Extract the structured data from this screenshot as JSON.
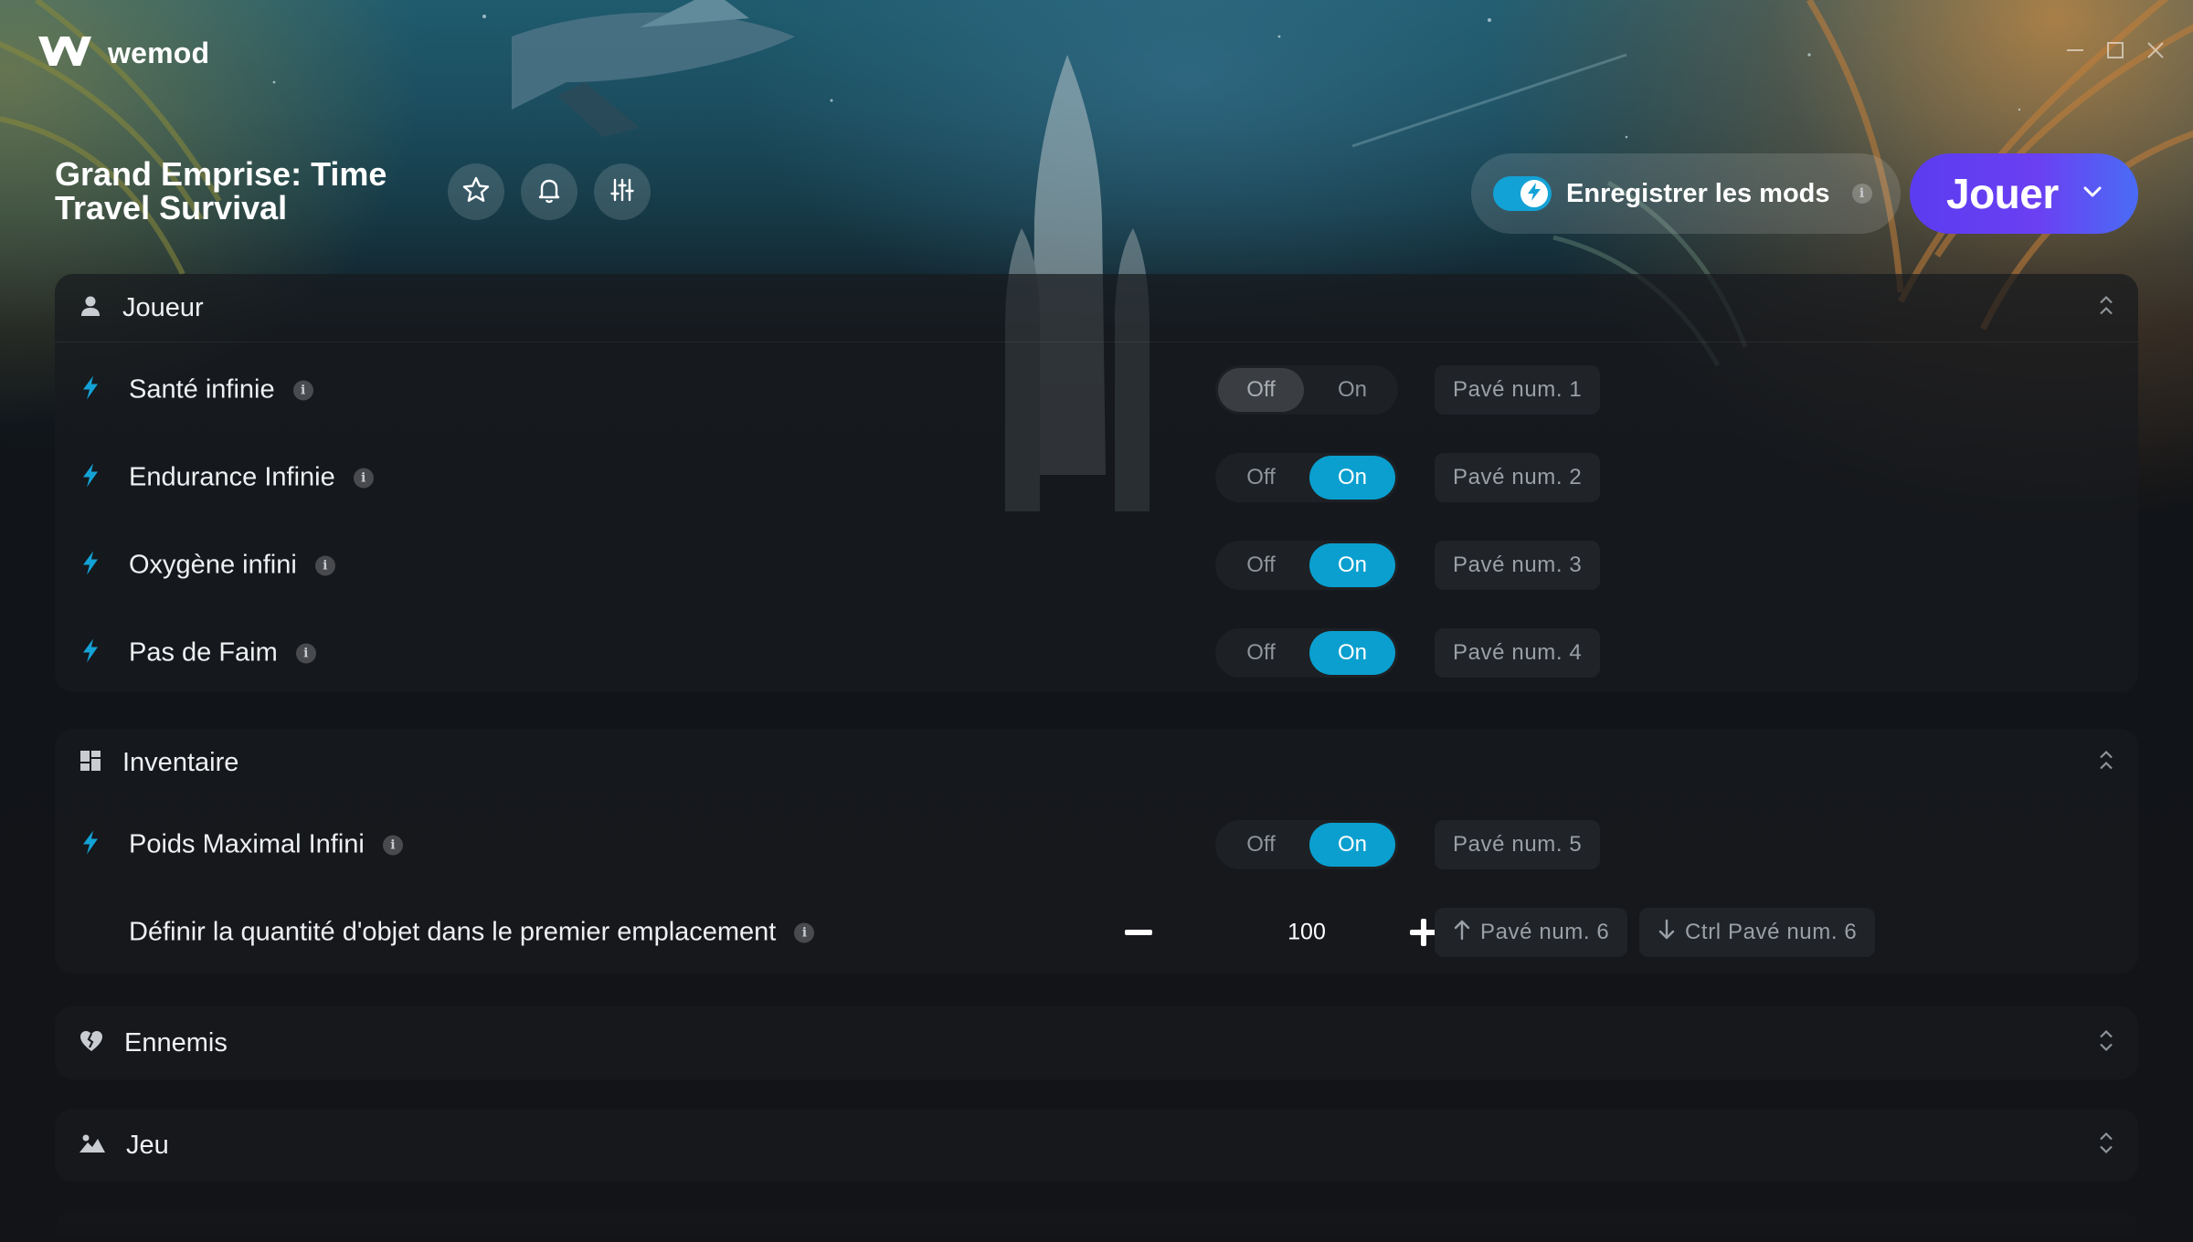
{
  "app": {
    "brand_name": "wemod",
    "accent_color": "#0a9fcf",
    "play_gradient": [
      "#5b3cf0",
      "#4a6cf5"
    ]
  },
  "header": {
    "game_title": "Grand Emprise: Time Travel Survival",
    "icons": [
      "star-icon",
      "bell-icon",
      "sliders-icon"
    ],
    "save_mods": {
      "label": "Enregistrer les mods",
      "enabled": true,
      "info": "i"
    },
    "play": {
      "label": "Jouer"
    }
  },
  "sections": [
    {
      "title": "Joueur",
      "icon": "user-icon",
      "expanded": true,
      "mods": [
        {
          "label": "Santé infinie",
          "off": "Off",
          "on": "On",
          "state": "off",
          "hotkey": "Pavé num. 1"
        },
        {
          "label": "Endurance Infinie",
          "off": "Off",
          "on": "On",
          "state": "on",
          "hotkey": "Pavé num. 2"
        },
        {
          "label": "Oxygène infini",
          "off": "Off",
          "on": "On",
          "state": "on",
          "hotkey": "Pavé num. 3"
        },
        {
          "label": "Pas de Faim",
          "off": "Off",
          "on": "On",
          "state": "on",
          "hotkey": "Pavé num. 4"
        }
      ]
    },
    {
      "title": "Inventaire",
      "icon": "dashboard-icon",
      "expanded": true,
      "mods": [
        {
          "label": "Poids Maximal Infini",
          "off": "Off",
          "on": "On",
          "state": "on",
          "hotkey": "Pavé num. 5"
        }
      ],
      "stepper": {
        "label": "Définir la quantité d'objet dans le premier emplacement",
        "value": "100",
        "hotkey_up": "Pavé num. 6",
        "hotkey_down": "Ctrl Pavé num. 6"
      }
    },
    {
      "title": "Ennemis",
      "icon": "broken-heart-icon",
      "expanded": false
    },
    {
      "title": "Jeu",
      "icon": "landscape-icon",
      "expanded": false
    }
  ]
}
